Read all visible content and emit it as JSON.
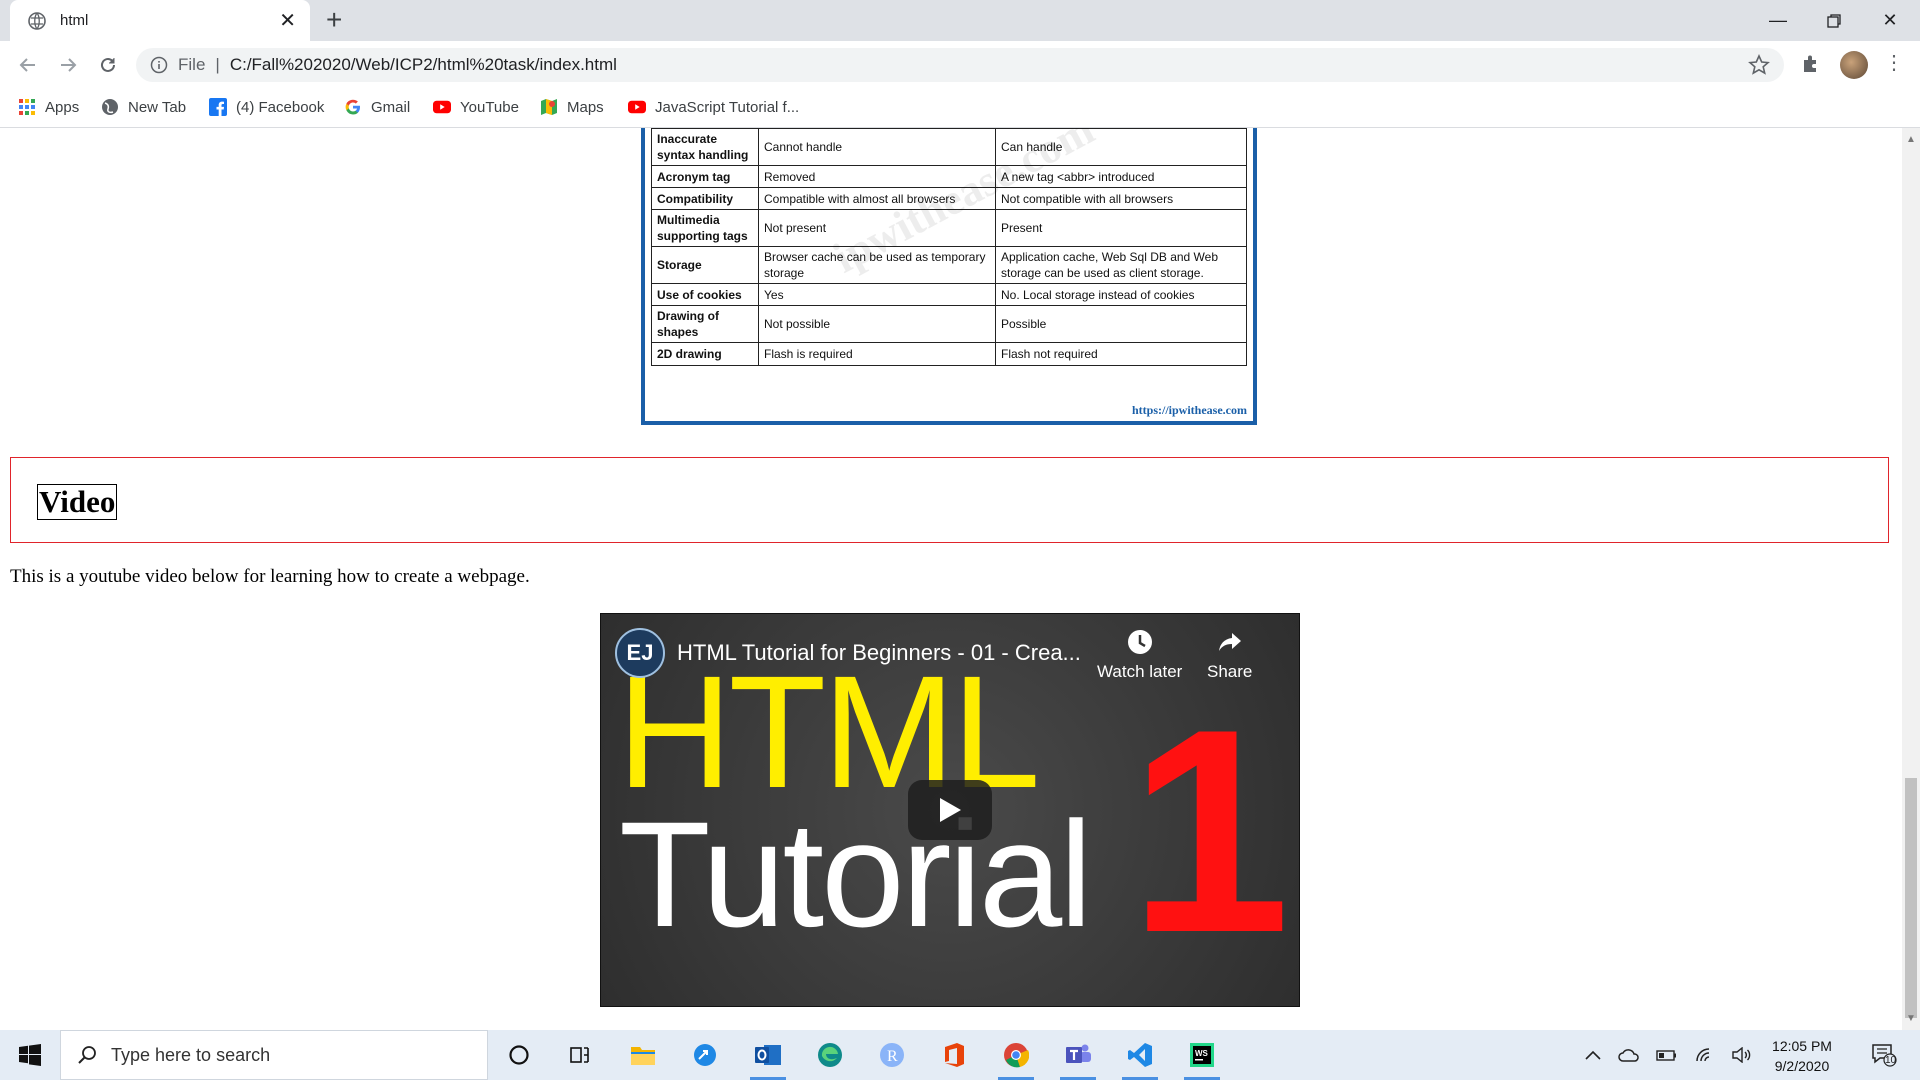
{
  "browser": {
    "tab_title": "html",
    "url_scheme": "File",
    "url": "C:/Fall%202020/Web/ICP2/html%20task/index.html",
    "bookmarks": [
      "Apps",
      "New Tab",
      "(4) Facebook",
      "Gmail",
      "YouTube",
      "Maps",
      "JavaScript Tutorial f..."
    ]
  },
  "page": {
    "comparison_table": {
      "rows": [
        {
          "feature": "Inaccurate syntax handling",
          "html": "Cannot handle",
          "html5": "Can handle"
        },
        {
          "feature": "Acronym tag",
          "html": "Removed",
          "html5": "A new tag <abbr> introduced"
        },
        {
          "feature": "Compatibility",
          "html": "Compatible with almost all browsers",
          "html5": "Not compatible with all browsers"
        },
        {
          "feature": "Multimedia supporting tags",
          "html": "Not present",
          "html5": "Present"
        },
        {
          "feature": "Storage",
          "html": "Browser cache can be used as temporary storage",
          "html5": "Application cache, Web Sql DB and Web storage can be used as client storage."
        },
        {
          "feature": "Use of cookies",
          "html": "Yes",
          "html5": "No. Local storage instead of cookies"
        },
        {
          "feature": "Drawing of shapes",
          "html": "Not possible",
          "html5": "Possible"
        },
        {
          "feature": "2D drawing",
          "html": "Flash is required",
          "html5": "Flash not required"
        }
      ],
      "source": "https://ipwithease.com",
      "watermark": "ipwithease.com"
    },
    "section_heading": "Video",
    "description": "This is a youtube video below for learning how to create a webpage.",
    "video": {
      "channel": "EJ",
      "title": "HTML Tutorial for Beginners - 01 - Crea...",
      "watch_later": "Watch later",
      "share": "Share",
      "thumb_line1": "HTML",
      "thumb_line2": "Tutorial",
      "thumb_number": "1"
    }
  },
  "taskbar": {
    "search_placeholder": "Type here to search",
    "time": "12:05 PM",
    "date": "9/2/2020",
    "notifications": "10"
  },
  "colors": {
    "tabbar": "#dee1e6",
    "taskbar": "#e4ecf5",
    "video_border": "#e0242b",
    "table_border": "#1a5fa8",
    "html_yellow": "#ffee00",
    "number_red": "#ff1111"
  }
}
